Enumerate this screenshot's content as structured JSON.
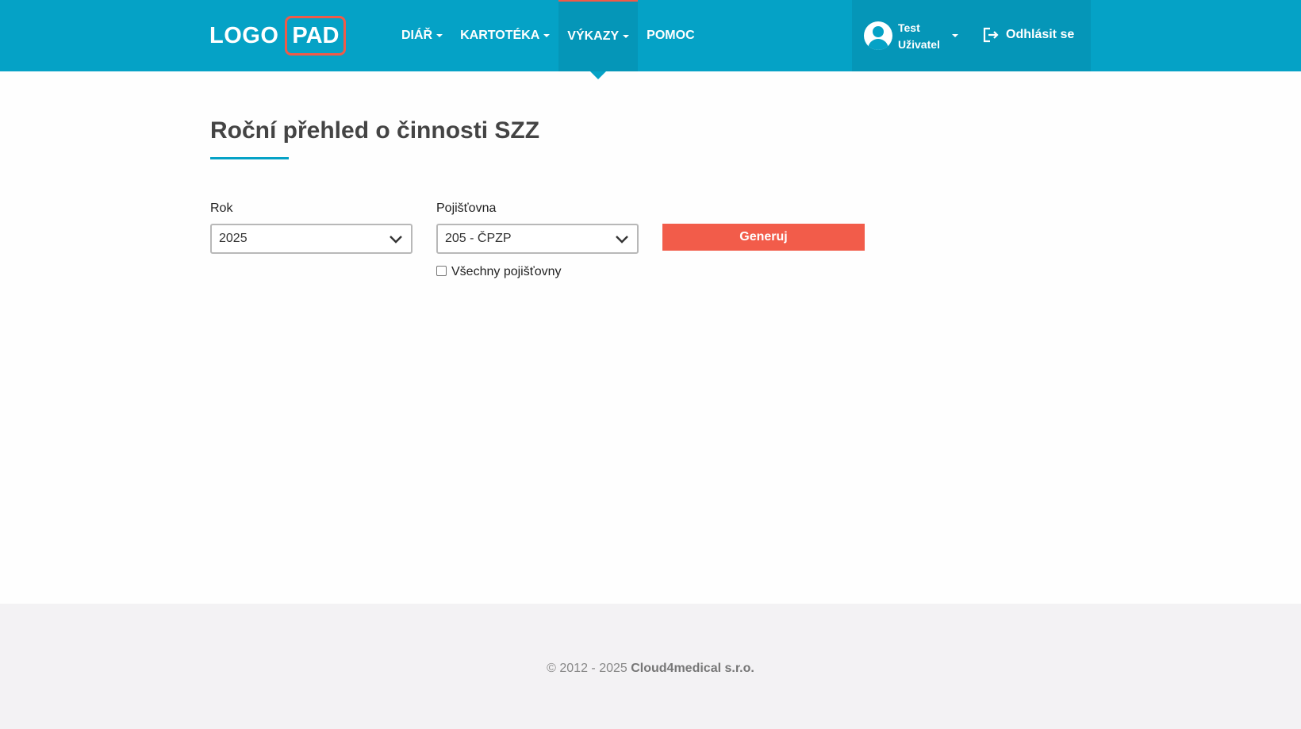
{
  "header": {
    "logo_left": "LOGO",
    "logo_right": "PAD",
    "nav": [
      {
        "label": "DIÁŘ",
        "dropdown": true
      },
      {
        "label": "KARTOTÉKA",
        "dropdown": true
      },
      {
        "label": "VÝKAZY",
        "dropdown": true,
        "active": true
      },
      {
        "label": "POMOC",
        "dropdown": false
      }
    ],
    "user": {
      "first": "Test",
      "last": "Uživatel"
    },
    "logout_label": "Odhlásit se"
  },
  "main": {
    "title": "Roční přehled o činnosti SZZ",
    "year": {
      "label": "Rok",
      "value": "2025"
    },
    "insurer": {
      "label": "Pojišťovna",
      "value": "205 - ČPZP"
    },
    "all_insurers_label": "Všechny pojišťovny",
    "all_insurers_checked": false,
    "generate_label": "Generuj"
  },
  "footer": {
    "copyright_prefix": "© 2012 - 2025",
    "company": "Cloud4medical s.r.o."
  },
  "colors": {
    "header": "#05a2c6",
    "header_dark": "#0596b8",
    "accent": "#f25c4a"
  }
}
